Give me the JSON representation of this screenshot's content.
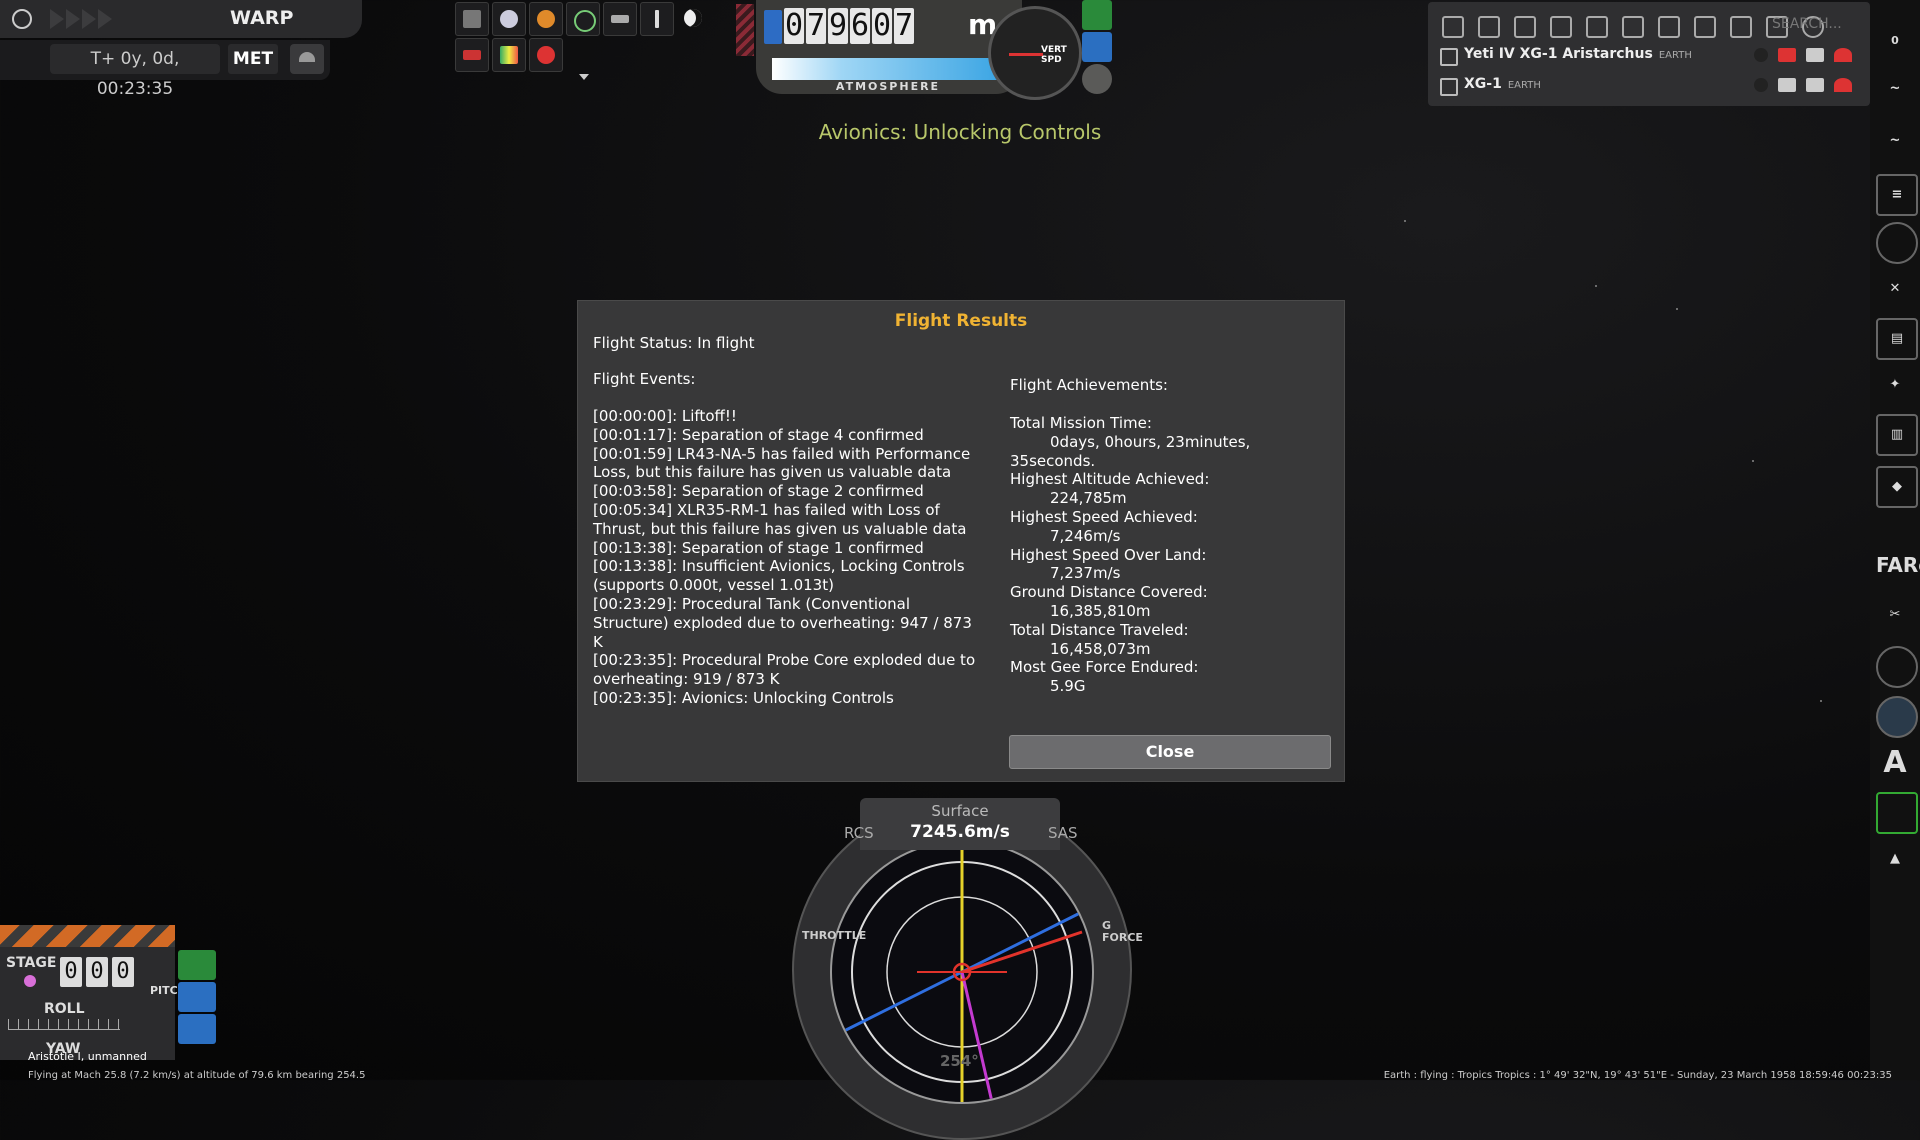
{
  "time": {
    "warp_label": "WARP",
    "met_time": "T+ 0y, 0d, 00:23:35",
    "met_label": "MET"
  },
  "altimeter": {
    "digits": [
      "0",
      "7",
      "9",
      "6",
      "0",
      "7"
    ],
    "unit": "m",
    "mode_label": "ATMOSPHERE",
    "vspd_label_line1": "VERT",
    "vspd_label_line2": "SPD"
  },
  "status_message": "Avionics: Unlocking Controls",
  "vessel_list": {
    "search_placeholder": "SEARCH...",
    "vessels": [
      {
        "name": "Yeti IV XG-1 Aristarchus",
        "body": "EARTH"
      },
      {
        "name": "XG-1",
        "body": "EARTH"
      }
    ]
  },
  "app_bar": {
    "items": [
      "comms-icon",
      "graph-icon",
      "graph-icon",
      "list-icon",
      "alarm-icon",
      "tools-icon",
      "clipboard-icon",
      "settings-icon",
      "film-icon",
      "tag-icon",
      "FARc",
      "scissors-icon",
      "gauge-icon",
      "ro-icon",
      "A",
      "stack-icon",
      "rocket-icon"
    ],
    "comms_count": "0",
    "far_label": "FARc",
    "a_label": "A"
  },
  "dialog": {
    "title": "Flight Results",
    "status": "Flight Status: In flight",
    "events_label": "Flight Events:",
    "events": [
      "[00:00:00]: Liftoff!!",
      "[00:01:17]: Separation of stage 4 confirmed",
      "[00:01:59] LR43-NA-5 has failed with Performance Loss, but this failure has given us valuable data",
      "[00:03:58]: Separation of stage 2 confirmed",
      "[00:05:34] XLR35-RM-1 has failed with Loss of Thrust, but this failure has given us valuable data",
      "[00:13:38]: Separation of stage 1 confirmed",
      "[00:13:38]: Insufficient Avionics, Locking Controls (supports 0.000t, vessel 1.013t)",
      "[00:23:29]: Procedural Tank (Conventional Structure) exploded due to overheating: 947 / 873 K",
      "[00:23:35]: Procedural Probe Core exploded due to overheating: 919 / 873 K",
      "[00:23:35]: Avionics: Unlocking Controls"
    ],
    "achievements_label": "Flight Achievements:",
    "achievements": [
      {
        "label": "Total Mission Time:",
        "value": "0days, 0hours, 23minutes, 35seconds."
      },
      {
        "label": "Highest Altitude Achieved:",
        "value": "224,785m"
      },
      {
        "label": "Highest Speed Achieved:",
        "value": "7,246m/s"
      },
      {
        "label": "Highest Speed Over Land:",
        "value": "7,237m/s"
      },
      {
        "label": "Ground Distance Covered:",
        "value": "16,385,810m"
      },
      {
        "label": "Total Distance Traveled:",
        "value": "16,458,073m"
      },
      {
        "label": "Most Gee Force Endured:",
        "value": "5.9G"
      }
    ],
    "close_label": "Close"
  },
  "navball": {
    "mode": "Surface",
    "speed": "7245.6m/s",
    "rcs_label": "RCS",
    "sas_label": "SAS",
    "throttle_label": "THROTTLE",
    "gforce_label": "G FORCE",
    "heading": "254°"
  },
  "staging": {
    "stage_label": "STAGE",
    "stage_digits": [
      "0",
      "0",
      "0"
    ],
    "roll_label": "ROLL",
    "yaw_label": "YAW",
    "pitch_label": "PITCH"
  },
  "footer": {
    "vessel_info": "Aristotle I, unmanned",
    "flight_info": "Flying at Mach 25.8 (7.2 km/s) at altitude of 79.6 km bearing 254.5",
    "location_info": "Earth : flying : Tropics Tropics : 1° 49' 32\"N, 19° 43' 51\"E - Sunday, 23 March 1958 18:59:46 00:23:35"
  },
  "colors": {
    "title_accent": "#f0b333",
    "status_message": "#b8c76a",
    "dialog_bg": "#383839"
  }
}
